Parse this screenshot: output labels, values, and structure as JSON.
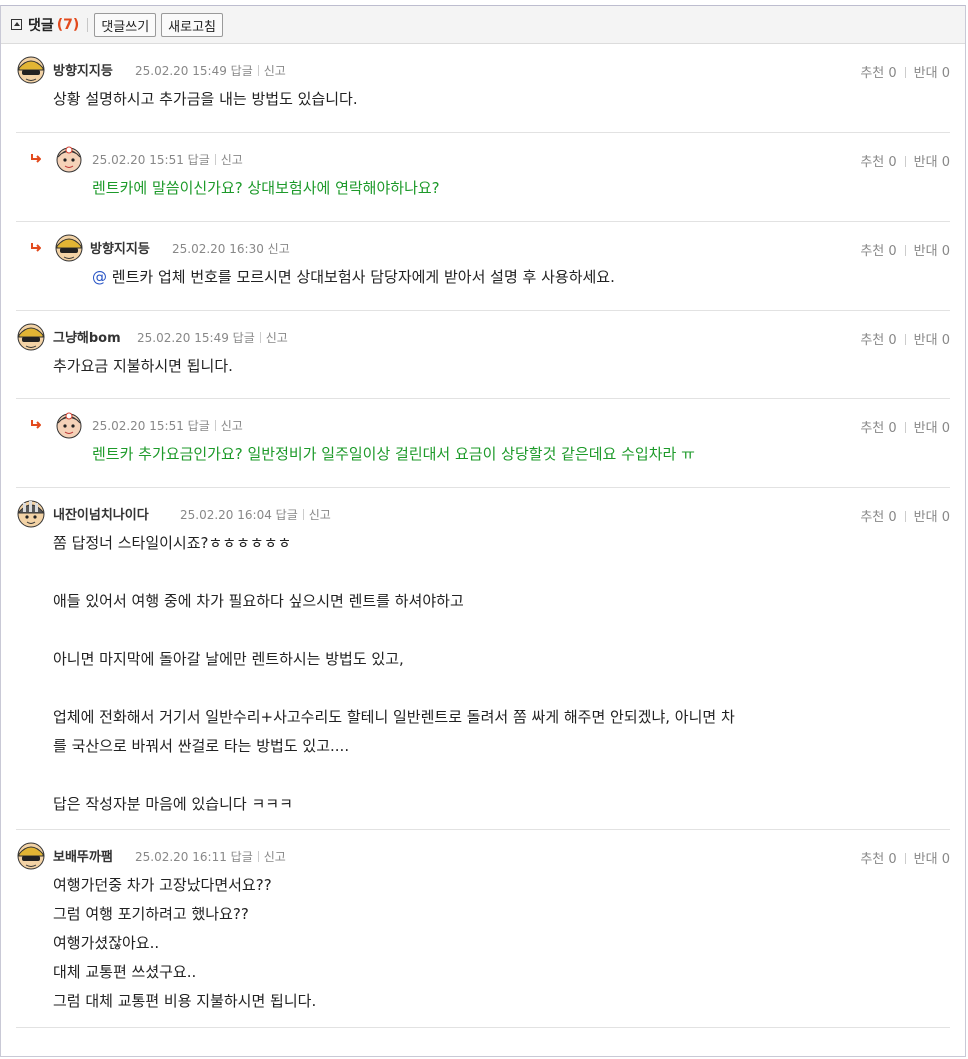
{
  "header": {
    "title": "댓글",
    "count": "(7)",
    "write_button": "댓글쓰기",
    "refresh_button": "새로고침"
  },
  "labels": {
    "reply": "답글",
    "report": "신고",
    "recommend": "추천",
    "oppose": "반대"
  },
  "comments": [
    {
      "nick": "방향지지등",
      "date": "25.02.20 15:49",
      "up": "0",
      "down": "0",
      "text": [
        "상황 설명하시고 추가금을 내는 방법도 있습니다."
      ]
    },
    {
      "nick": "",
      "date": "25.02.20 15:51",
      "up": "0",
      "down": "0",
      "text": [
        "렌트카에 말씀이신가요? 상대보험사에 연락해야하나요?"
      ]
    },
    {
      "nick": "방향지지등",
      "date": "25.02.20 16:30",
      "up": "0",
      "down": "0",
      "mention": "@",
      "text": [
        "렌트카 업체 번호를 모르시면 상대보험사 담당자에게 받아서 설명 후 사용하세요."
      ]
    },
    {
      "nick": "그냥해bom",
      "date": "25.02.20 15:49",
      "up": "0",
      "down": "0",
      "text": [
        "추가요금 지불하시면 됩니다."
      ]
    },
    {
      "nick": "",
      "date": "25.02.20 15:51",
      "up": "0",
      "down": "0",
      "text": [
        "렌트카 추가요금인가요? 일반정비가 일주일이상 걸린대서 요금이 상당할것 같은데요 수입차라 ㅠ"
      ]
    },
    {
      "nick": "내잔이넘치나이다",
      "date": "25.02.20 16:04",
      "up": "0",
      "down": "0",
      "text": [
        "쫌 답정너 스타일이시죠?ㅎㅎㅎㅎㅎㅎ",
        "",
        "애들 있어서 여행 중에 차가 필요하다 싶으시면 렌트를 하셔야하고",
        "",
        "아니면 마지막에 돌아갈 날에만 렌트하시는 방법도 있고,",
        "",
        "업체에 전화해서 거기서 일반수리+사고수리도 할테니 일반렌트로 돌려서 쫌 싸게 해주면 안되겠냐, 아니면 차",
        "를 국산으로 바꿔서 싼걸로 타는 방법도 있고....",
        "",
        "답은 작성자분 마음에 있습니다 ㅋㅋㅋ"
      ]
    },
    {
      "nick": "보배뚜까팸",
      "date": "25.02.20 16:11",
      "up": "0",
      "down": "0",
      "text": [
        "여행가던중 차가 고장났다면서요??",
        "그럼 여행 포기하려고 했나요??",
        "여행가셨잖아요..",
        "대체 교통편 쓰셨구요..",
        "그럼 대체 교통편 비용 지불하시면 됩니다."
      ]
    }
  ]
}
